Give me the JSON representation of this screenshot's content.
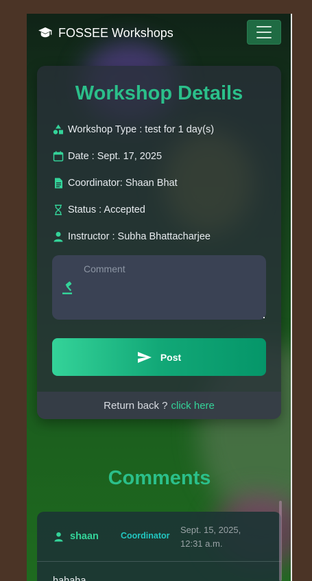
{
  "navbar": {
    "brand": "FOSSEE Workshops",
    "brand_icon": "graduation-cap-icon",
    "toggle_icon": "hamburger-menu-icon"
  },
  "details": {
    "title": "Workshop Details",
    "workshop_type": "Workshop Type : test for 1 day(s)",
    "date": "Date : Sept. 17, 2025",
    "coordinator": "Coordinator: Shaan Bhat",
    "status": "Status : Accepted",
    "instructor": "Instructor : Subha Bhattacharjee"
  },
  "comment_form": {
    "placeholder": "Comment",
    "value": "",
    "post_label": "Post"
  },
  "footer": {
    "prompt": "Return back ?",
    "link_label": "click here"
  },
  "comments": {
    "heading": "Comments",
    "items": [
      {
        "author": "shaan",
        "role": "Coordinator",
        "time": "Sept. 15, 2025, 12:31 a.m.",
        "body": "hahaha"
      }
    ]
  },
  "colors": {
    "accent": "#2bbf8a",
    "role": "#22c7c1",
    "button_start": "#34d399",
    "button_end": "#059669"
  }
}
